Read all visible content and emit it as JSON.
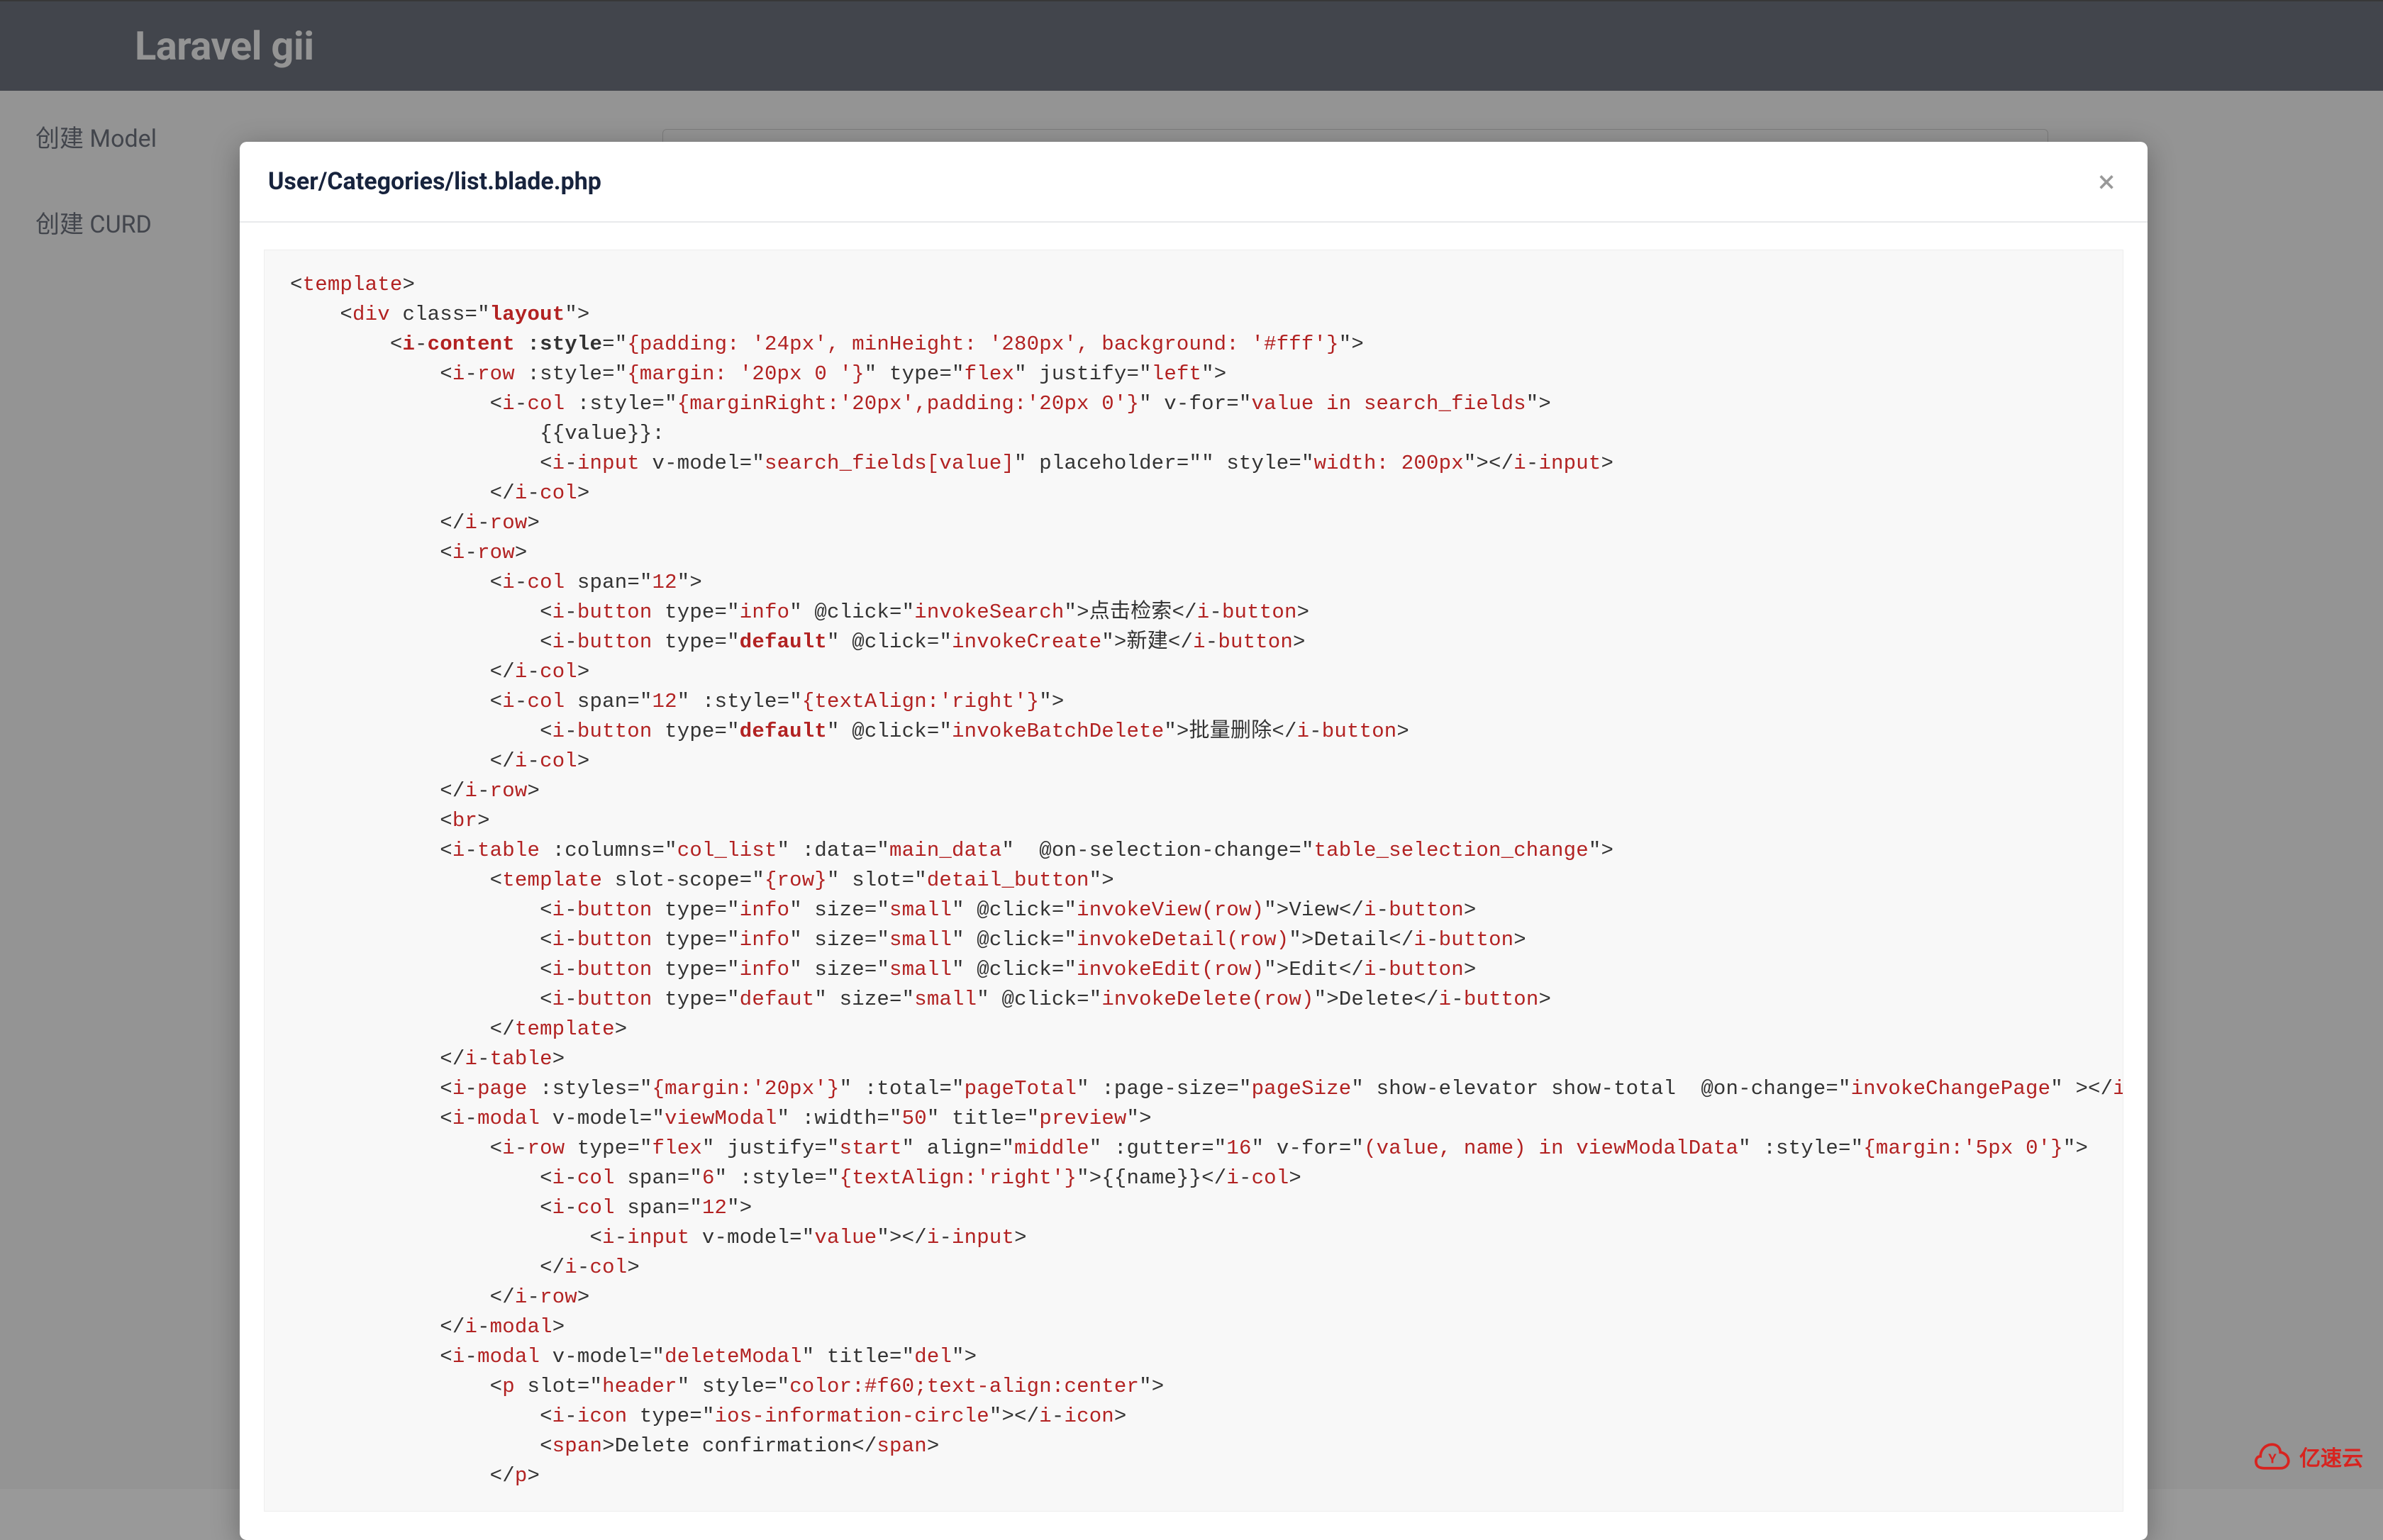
{
  "header": {
    "title": "Laravel gii"
  },
  "sidebar": {
    "items": [
      {
        "label": "创建 Model"
      },
      {
        "label": "创建 CURD"
      }
    ]
  },
  "modal": {
    "title": "User/Categories/list.blade.php",
    "close_icon_label": "×"
  },
  "watermark": {
    "brand": "亿速云"
  },
  "code": {
    "lines": [
      {
        "raw": "<template>"
      },
      {
        "raw": "    <div class=\"layout\">",
        "bold_vals": [
          "layout"
        ]
      },
      {
        "raw": "        <i-content :style=\"{padding: '24px', minHeight: '280px', background: '#fff'}\">",
        "bold_tokens": [
          "i",
          "content",
          "style"
        ]
      },
      {
        "raw": "            <i-row :style=\"{margin: '20px 0 '}\" type=\"flex\" justify=\"left\">"
      },
      {
        "raw": "                <i-col :style=\"{marginRight:'20px',padding:'20px 0'}\" v-for=\"value in search_fields\">"
      },
      {
        "raw": "                    {{value}}:"
      },
      {
        "raw": "                    <i-input v-model=\"search_fields[value]\" placeholder=\"\" style=\"width: 200px\"></i-input>"
      },
      {
        "raw": "                </i-col>"
      },
      {
        "raw": "            </i-row>"
      },
      {
        "raw": "            <i-row>"
      },
      {
        "raw": "                <i-col span=\"12\">"
      },
      {
        "raw": "                    <i-button type=\"info\" @click=\"invokeSearch\">点击检索</i-button>"
      },
      {
        "raw": "                    <i-button type=\"default\" @click=\"invokeCreate\">新建</i-button>",
        "bold_vals": [
          "default"
        ]
      },
      {
        "raw": "                </i-col>"
      },
      {
        "raw": "                <i-col span=\"12\" :style=\"{textAlign:'right'}\">"
      },
      {
        "raw": "                    <i-button type=\"default\" @click=\"invokeBatchDelete\">批量删除</i-button>",
        "bold_vals": [
          "default"
        ]
      },
      {
        "raw": "                </i-col>"
      },
      {
        "raw": "            </i-row>"
      },
      {
        "raw": "            <br>"
      },
      {
        "raw": "            <i-table :columns=\"col_list\" :data=\"main_data\"  @on-selection-change=\"table_selection_change\">"
      },
      {
        "raw": "                <template slot-scope=\"{row}\" slot=\"detail_button\">"
      },
      {
        "raw": "                    <i-button type=\"info\" size=\"small\" @click=\"invokeView(row)\">View</i-button>"
      },
      {
        "raw": "                    <i-button type=\"info\" size=\"small\" @click=\"invokeDetail(row)\">Detail</i-button>"
      },
      {
        "raw": "                    <i-button type=\"info\" size=\"small\" @click=\"invokeEdit(row)\">Edit</i-button>"
      },
      {
        "raw": "                    <i-button type=\"defaut\" size=\"small\" @click=\"invokeDelete(row)\">Delete</i-button>"
      },
      {
        "raw": "                </template>"
      },
      {
        "raw": "            </i-table>"
      },
      {
        "raw": "            <i-page :styles=\"{margin:'20px'}\" :total=\"pageTotal\" :page-size=\"pageSize\" show-elevator show-total  @on-change=\"invokeChangePage\" ></i-page>"
      },
      {
        "raw": "            <i-modal v-model=\"viewModal\" :width=\"50\" title=\"preview\">"
      },
      {
        "raw": "                <i-row type=\"flex\" justify=\"start\" align=\"middle\" :gutter=\"16\" v-for=\"(value, name) in viewModalData\" :style=\"{margin:'5px 0'}\">"
      },
      {
        "raw": "                    <i-col span=\"6\" :style=\"{textAlign:'right'}\">{{name}}</i-col>"
      },
      {
        "raw": "                    <i-col span=\"12\">"
      },
      {
        "raw": "                        <i-input v-model=\"value\"></i-input>"
      },
      {
        "raw": "                    </i-col>"
      },
      {
        "raw": "                </i-row>"
      },
      {
        "raw": "            </i-modal>"
      },
      {
        "raw": "            <i-modal v-model=\"deleteModal\" title=\"del\">"
      },
      {
        "raw": "                <p slot=\"header\" style=\"color:#f60;text-align:center\">"
      },
      {
        "raw": "                    <i-icon type=\"ios-information-circle\"></i-icon>"
      },
      {
        "raw": "                    <span>Delete confirmation</span>"
      },
      {
        "raw": "                </p>"
      }
    ]
  }
}
